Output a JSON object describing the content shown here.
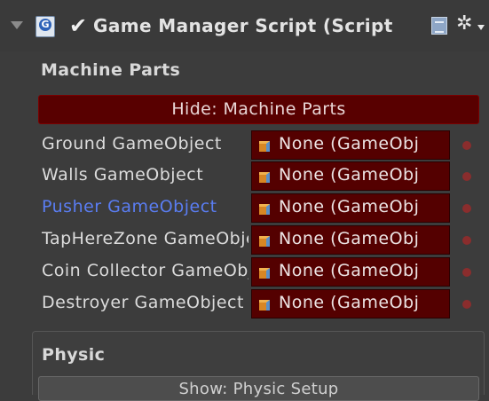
{
  "header": {
    "title": "Game Manager Script (Script",
    "enabled_check": "✔",
    "script_icon_glyph": "G",
    "gear_glyph": "✲"
  },
  "sections": {
    "machine_parts": {
      "label": "Machine Parts",
      "toggle_label": "Hide: Machine Parts"
    },
    "physic": {
      "label": "Physic",
      "toggle_label": "Show: Physic Setup"
    }
  },
  "fields": [
    {
      "label": "Ground GameObject",
      "value": "None (GameObj",
      "active": false
    },
    {
      "label": "Walls GameObject",
      "value": "None (GameObj",
      "active": false
    },
    {
      "label": "Pusher GameObject",
      "value": "None (GameObj",
      "active": true
    },
    {
      "label": "TapHereZone GameObject",
      "value": "None (GameObj",
      "active": false
    },
    {
      "label": "Coin Collector GameObject",
      "value": "None (GameObj",
      "active": false
    },
    {
      "label": "Destroyer GameObject",
      "value": "None (GameObj",
      "active": false
    }
  ],
  "colors": {
    "background": "#3c3c3c",
    "button_red": "#580000",
    "field_red": "#540000",
    "active_label": "#5a7df2"
  }
}
